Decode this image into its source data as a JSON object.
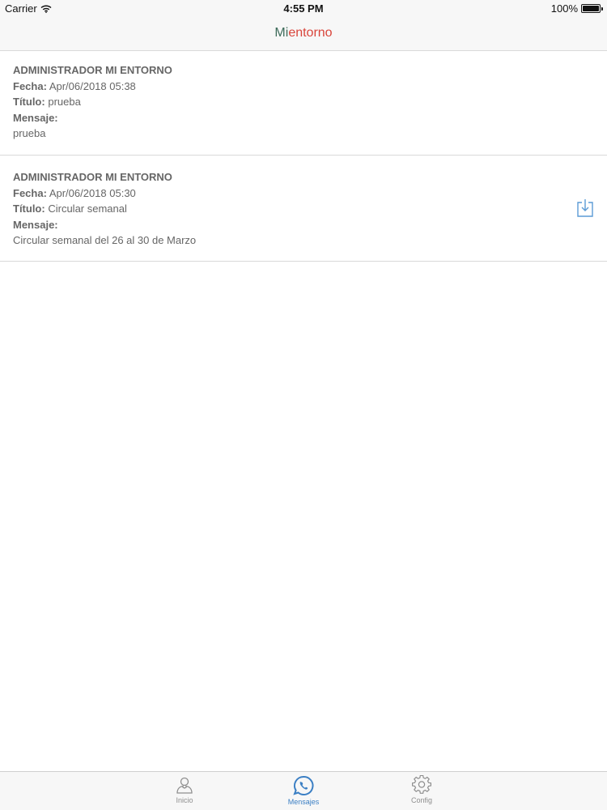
{
  "status_bar": {
    "carrier": "Carrier",
    "time": "4:55 PM",
    "battery": "100%",
    "battery_level": 1.0
  },
  "nav": {
    "title_part1": "Mi",
    "title_part2": "entorno",
    "title_color1": "#3d6b5a",
    "title_color2": "#d9453b"
  },
  "labels": {
    "fecha": "Fecha:",
    "titulo": "Título:",
    "mensaje": "Mensaje:"
  },
  "messages": [
    {
      "sender": "ADMINISTRADOR MI ENTORNO",
      "fecha": "Apr/06/2018 05:38",
      "titulo": "prueba",
      "mensaje": "prueba",
      "has_attachment": false
    },
    {
      "sender": "ADMINISTRADOR MI ENTORNO",
      "fecha": "Apr/06/2018 05:30",
      "titulo": "Circular semanal",
      "mensaje": "Circular semanal del 26 al 30 de Marzo",
      "has_attachment": true,
      "attachment_icon": "download-icon"
    }
  ],
  "tabs": [
    {
      "label": "Inicio",
      "icon": "person-icon",
      "active": false
    },
    {
      "label": "Mensajes",
      "icon": "chat-phone-icon",
      "active": true
    },
    {
      "label": "Config",
      "icon": "gear-icon",
      "active": false
    }
  ],
  "colors": {
    "accent": "#3b7fc4",
    "inactive": "#8e8e8e"
  }
}
